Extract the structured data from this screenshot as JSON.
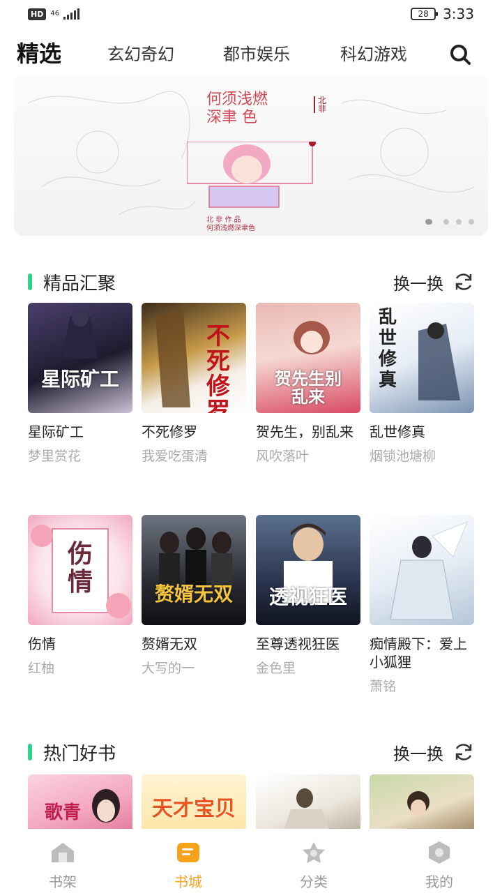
{
  "status_bar": {
    "hd": "HD",
    "network": "46",
    "battery": "28",
    "time": "3:33"
  },
  "top_tabs": [
    {
      "label": "精选",
      "active": true
    },
    {
      "label": "玄幻奇幻",
      "active": false
    },
    {
      "label": "都市娱乐",
      "active": false
    },
    {
      "label": "科幻游戏",
      "active": false
    }
  ],
  "banner": {
    "title_line1": "何须浅燃",
    "title_line2": "深聿 色",
    "caption_line1": "北 非 作 品",
    "caption_line2": "何须浅燃深聿色",
    "slide_count": 4,
    "active_slide": 0
  },
  "section1": {
    "title": "精品汇聚",
    "refresh_label": "换一换",
    "books": [
      {
        "title": "星际矿工",
        "author": "梦里赏花",
        "cover_text": "星际矿工"
      },
      {
        "title": "不死修罗",
        "author": "我爱吃蛋清",
        "cover_text": "不死修罗"
      },
      {
        "title": "贺先生，别乱来",
        "author": "风吹落叶",
        "cover_text": "贺先生别乱来"
      },
      {
        "title": "乱世修真",
        "author": "烟锁池塘柳",
        "cover_text": "乱世修真"
      },
      {
        "title": "伤情",
        "author": "红柚",
        "cover_text": "伤情"
      },
      {
        "title": "赘婿无双",
        "author": "大写的一",
        "cover_text": "赘婿无双"
      },
      {
        "title": "至尊透视狂医",
        "author": "金色里",
        "cover_text": "透视狂医"
      },
      {
        "title": "痴情殿下：爱上小狐狸",
        "author": "萧铭",
        "cover_text": ""
      }
    ]
  },
  "section2": {
    "title": "热门好书",
    "refresh_label": "换一换",
    "covers": [
      "歌青",
      "天才宝贝",
      "",
      ""
    ]
  },
  "bottom_nav": [
    {
      "label": "书架",
      "icon": "house-icon",
      "active": false
    },
    {
      "label": "书城",
      "icon": "book-store-icon",
      "active": true
    },
    {
      "label": "分类",
      "icon": "star-icon",
      "active": false
    },
    {
      "label": "我的",
      "icon": "profile-hexagon-icon",
      "active": false
    }
  ],
  "colors": {
    "accent": "#f7a21b",
    "section_bar": "#2fd38a",
    "muted_text": "#aaaaaa"
  }
}
